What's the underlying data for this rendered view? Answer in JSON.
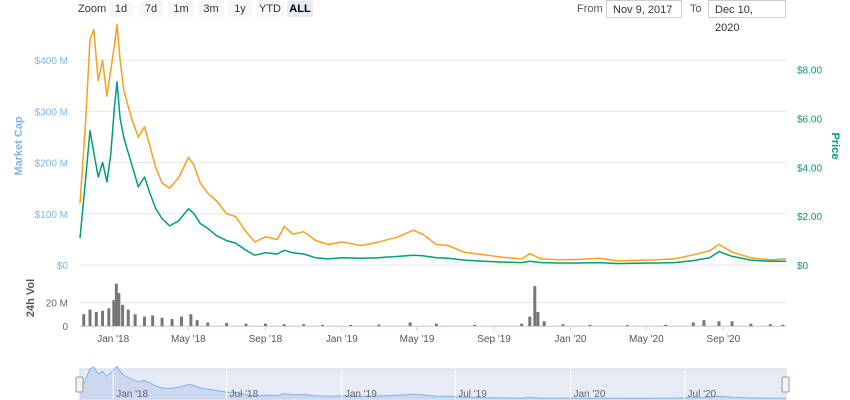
{
  "toolbar": {
    "zoom_label": "Zoom",
    "zoom_buttons": [
      "1d",
      "7d",
      "1m",
      "3m",
      "1y",
      "YTD",
      "ALL"
    ],
    "active_zoom": "ALL",
    "from_label": "From",
    "from_value": "Nov 9, 2017",
    "to_label": "To",
    "to_value": "Dec 10, 2020"
  },
  "colors": {
    "market_cap": "#f7a11a",
    "price": "#009e73",
    "volume": "#777777",
    "left_axis_label": "#7cb5ec",
    "right_axis_label": "#009e73",
    "navigator_bg": "#e6ebf5"
  },
  "chart_data": {
    "type": "line",
    "x_range": [
      "2017-11-09",
      "2020-12-10"
    ],
    "x_ticks": [
      {
        "date": "2018-01-01",
        "label": "Jan '18"
      },
      {
        "date": "2018-05-01",
        "label": "May '18"
      },
      {
        "date": "2018-09-01",
        "label": "Sep '18"
      },
      {
        "date": "2019-01-01",
        "label": "Jan '19"
      },
      {
        "date": "2019-05-01",
        "label": "May '19"
      },
      {
        "date": "2019-09-01",
        "label": "Sep '19"
      },
      {
        "date": "2020-01-01",
        "label": "Jan '20"
      },
      {
        "date": "2020-05-01",
        "label": "May '20"
      },
      {
        "date": "2020-09-01",
        "label": "Sep '20"
      }
    ],
    "y_left": {
      "label": "Market Cap",
      "range": [
        0,
        420000000
      ],
      "ticks": [
        0,
        100000000,
        200000000,
        300000000,
        400000000
      ],
      "tick_labels": [
        "$0",
        "$100 M",
        "$200 M",
        "$300 M",
        "$400 M"
      ]
    },
    "y_right": {
      "label": "Price",
      "range": [
        0,
        8.8
      ],
      "ticks": [
        0,
        2,
        4,
        6,
        8
      ],
      "tick_labels": [
        "$0",
        "$2.00",
        "$4.00",
        "$6.00",
        "$8.00"
      ]
    },
    "y_volume": {
      "label": "24h Vol",
      "range": [
        0,
        40000000
      ],
      "ticks": [
        0,
        20000000
      ],
      "tick_labels": [
        "0",
        "20 M"
      ]
    },
    "series": [
      {
        "name": "Market Cap",
        "axis": "left",
        "points": [
          [
            "2017-11-09",
            120000000
          ],
          [
            "2017-11-18",
            280000000
          ],
          [
            "2017-11-25",
            440000000
          ],
          [
            "2017-12-01",
            460000000
          ],
          [
            "2017-12-08",
            360000000
          ],
          [
            "2017-12-15",
            400000000
          ],
          [
            "2017-12-22",
            330000000
          ],
          [
            "2017-12-28",
            380000000
          ],
          [
            "2018-01-03",
            430000000
          ],
          [
            "2018-01-07",
            470000000
          ],
          [
            "2018-01-12",
            400000000
          ],
          [
            "2018-01-18",
            340000000
          ],
          [
            "2018-01-25",
            310000000
          ],
          [
            "2018-02-01",
            280000000
          ],
          [
            "2018-02-10",
            250000000
          ],
          [
            "2018-02-20",
            270000000
          ],
          [
            "2018-03-01",
            230000000
          ],
          [
            "2018-03-10",
            190000000
          ],
          [
            "2018-03-20",
            160000000
          ],
          [
            "2018-04-01",
            150000000
          ],
          [
            "2018-04-15",
            170000000
          ],
          [
            "2018-05-01",
            210000000
          ],
          [
            "2018-05-10",
            195000000
          ],
          [
            "2018-05-20",
            160000000
          ],
          [
            "2018-06-01",
            140000000
          ],
          [
            "2018-06-15",
            125000000
          ],
          [
            "2018-07-01",
            100000000
          ],
          [
            "2018-07-15",
            95000000
          ],
          [
            "2018-08-01",
            65000000
          ],
          [
            "2018-08-15",
            45000000
          ],
          [
            "2018-09-01",
            55000000
          ],
          [
            "2018-09-20",
            50000000
          ],
          [
            "2018-10-01",
            75000000
          ],
          [
            "2018-10-15",
            60000000
          ],
          [
            "2018-11-01",
            65000000
          ],
          [
            "2018-11-20",
            48000000
          ],
          [
            "2018-12-10",
            40000000
          ],
          [
            "2019-01-01",
            45000000
          ],
          [
            "2019-02-01",
            38000000
          ],
          [
            "2019-03-01",
            45000000
          ],
          [
            "2019-04-01",
            55000000
          ],
          [
            "2019-04-25",
            68000000
          ],
          [
            "2019-05-10",
            60000000
          ],
          [
            "2019-06-01",
            40000000
          ],
          [
            "2019-06-20",
            38000000
          ],
          [
            "2019-07-15",
            25000000
          ],
          [
            "2019-08-15",
            20000000
          ],
          [
            "2019-09-15",
            15000000
          ],
          [
            "2019-10-15",
            12000000
          ],
          [
            "2019-10-28",
            22000000
          ],
          [
            "2019-11-15",
            12000000
          ],
          [
            "2019-12-15",
            10000000
          ],
          [
            "2020-01-15",
            11000000
          ],
          [
            "2020-02-15",
            13000000
          ],
          [
            "2020-03-15",
            8000000
          ],
          [
            "2020-04-15",
            9000000
          ],
          [
            "2020-05-15",
            10000000
          ],
          [
            "2020-06-15",
            12000000
          ],
          [
            "2020-07-15",
            20000000
          ],
          [
            "2020-08-10",
            28000000
          ],
          [
            "2020-08-25",
            40000000
          ],
          [
            "2020-09-15",
            25000000
          ],
          [
            "2020-10-15",
            14000000
          ],
          [
            "2020-11-15",
            10000000
          ],
          [
            "2020-12-10",
            12000000
          ]
        ]
      },
      {
        "name": "Price",
        "axis": "right",
        "points": [
          [
            "2017-11-09",
            1.1
          ],
          [
            "2017-11-18",
            3.5
          ],
          [
            "2017-11-25",
            5.5
          ],
          [
            "2017-12-01",
            4.6
          ],
          [
            "2017-12-08",
            3.6
          ],
          [
            "2017-12-15",
            4.2
          ],
          [
            "2017-12-22",
            3.4
          ],
          [
            "2017-12-28",
            4.5
          ],
          [
            "2018-01-03",
            6.5
          ],
          [
            "2018-01-07",
            7.5
          ],
          [
            "2018-01-12",
            6.0
          ],
          [
            "2018-01-18",
            5.2
          ],
          [
            "2018-01-25",
            4.6
          ],
          [
            "2018-02-01",
            4.0
          ],
          [
            "2018-02-10",
            3.2
          ],
          [
            "2018-02-20",
            3.6
          ],
          [
            "2018-03-01",
            2.9
          ],
          [
            "2018-03-10",
            2.3
          ],
          [
            "2018-03-20",
            1.9
          ],
          [
            "2018-04-01",
            1.6
          ],
          [
            "2018-04-15",
            1.8
          ],
          [
            "2018-05-01",
            2.3
          ],
          [
            "2018-05-10",
            2.1
          ],
          [
            "2018-05-20",
            1.7
          ],
          [
            "2018-06-01",
            1.5
          ],
          [
            "2018-06-15",
            1.2
          ],
          [
            "2018-07-01",
            1.0
          ],
          [
            "2018-07-15",
            0.9
          ],
          [
            "2018-08-01",
            0.6
          ],
          [
            "2018-08-15",
            0.4
          ],
          [
            "2018-09-01",
            0.5
          ],
          [
            "2018-09-20",
            0.45
          ],
          [
            "2018-10-01",
            0.6
          ],
          [
            "2018-10-15",
            0.5
          ],
          [
            "2018-11-01",
            0.45
          ],
          [
            "2018-11-20",
            0.3
          ],
          [
            "2018-12-10",
            0.25
          ],
          [
            "2019-01-01",
            0.3
          ],
          [
            "2019-02-01",
            0.28
          ],
          [
            "2019-03-01",
            0.3
          ],
          [
            "2019-04-01",
            0.35
          ],
          [
            "2019-04-25",
            0.4
          ],
          [
            "2019-05-10",
            0.38
          ],
          [
            "2019-06-01",
            0.3
          ],
          [
            "2019-06-20",
            0.28
          ],
          [
            "2019-07-15",
            0.2
          ],
          [
            "2019-08-15",
            0.15
          ],
          [
            "2019-09-15",
            0.12
          ],
          [
            "2019-10-15",
            0.1
          ],
          [
            "2019-10-28",
            0.15
          ],
          [
            "2019-11-15",
            0.1
          ],
          [
            "2019-12-15",
            0.08
          ],
          [
            "2020-01-15",
            0.08
          ],
          [
            "2020-02-15",
            0.1
          ],
          [
            "2020-03-15",
            0.06
          ],
          [
            "2020-04-15",
            0.07
          ],
          [
            "2020-05-15",
            0.08
          ],
          [
            "2020-06-15",
            0.1
          ],
          [
            "2020-07-15",
            0.18
          ],
          [
            "2020-08-10",
            0.3
          ],
          [
            "2020-08-25",
            0.55
          ],
          [
            "2020-09-15",
            0.35
          ],
          [
            "2020-10-15",
            0.2
          ],
          [
            "2020-11-15",
            0.15
          ],
          [
            "2020-12-10",
            0.15
          ]
        ]
      },
      {
        "name": "24h Vol",
        "axis": "volume",
        "type": "bar",
        "points": [
          [
            "2017-11-15",
            10000000
          ],
          [
            "2017-11-25",
            14000000
          ],
          [
            "2017-12-05",
            12000000
          ],
          [
            "2017-12-15",
            13000000
          ],
          [
            "2017-12-25",
            15000000
          ],
          [
            "2018-01-02",
            22000000
          ],
          [
            "2018-01-06",
            36000000
          ],
          [
            "2018-01-10",
            28000000
          ],
          [
            "2018-01-16",
            18000000
          ],
          [
            "2018-01-25",
            14000000
          ],
          [
            "2018-02-05",
            10000000
          ],
          [
            "2018-02-20",
            8000000
          ],
          [
            "2018-03-05",
            9000000
          ],
          [
            "2018-03-20",
            7000000
          ],
          [
            "2018-04-05",
            6000000
          ],
          [
            "2018-04-20",
            8000000
          ],
          [
            "2018-05-05",
            10000000
          ],
          [
            "2018-05-15",
            5000000
          ],
          [
            "2018-06-01",
            3000000
          ],
          [
            "2018-07-01",
            2500000
          ],
          [
            "2018-08-01",
            2000000
          ],
          [
            "2018-09-01",
            2000000
          ],
          [
            "2018-10-01",
            1500000
          ],
          [
            "2018-11-01",
            1500000
          ],
          [
            "2018-12-01",
            1000000
          ],
          [
            "2019-01-15",
            1000000
          ],
          [
            "2019-03-01",
            1200000
          ],
          [
            "2019-04-20",
            3000000
          ],
          [
            "2019-06-01",
            2000000
          ],
          [
            "2019-08-01",
            1000000
          ],
          [
            "2019-10-15",
            2000000
          ],
          [
            "2019-10-28",
            8000000
          ],
          [
            "2019-11-05",
            34000000
          ],
          [
            "2019-11-10",
            12000000
          ],
          [
            "2019-11-20",
            4000000
          ],
          [
            "2019-12-20",
            1500000
          ],
          [
            "2020-02-01",
            1000000
          ],
          [
            "2020-04-01",
            800000
          ],
          [
            "2020-06-01",
            1000000
          ],
          [
            "2020-07-15",
            3000000
          ],
          [
            "2020-08-01",
            5000000
          ],
          [
            "2020-08-25",
            4000000
          ],
          [
            "2020-09-15",
            4000000
          ],
          [
            "2020-10-15",
            2000000
          ],
          [
            "2020-11-15",
            1500000
          ],
          [
            "2020-12-05",
            1000000
          ]
        ]
      }
    ],
    "navigator": {
      "x_ticks": [
        {
          "date": "2018-01-01",
          "label": "Jan '18"
        },
        {
          "date": "2018-07-01",
          "label": "Jul '18"
        },
        {
          "date": "2019-01-01",
          "label": "Jan '19"
        },
        {
          "date": "2019-07-01",
          "label": "Jul '19"
        },
        {
          "date": "2020-01-01",
          "label": "Jan '20"
        },
        {
          "date": "2020-07-01",
          "label": "Jul '20"
        }
      ],
      "selection": [
        "2017-11-09",
        "2020-12-10"
      ]
    },
    "grid": true,
    "legend": "none"
  }
}
